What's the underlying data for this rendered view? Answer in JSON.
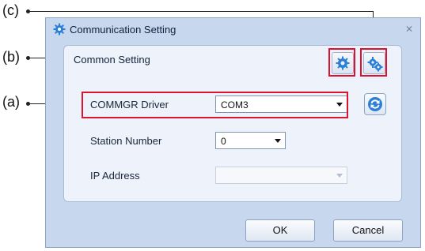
{
  "callouts": {
    "c": "(c)",
    "b": "(b)",
    "a": "(a)"
  },
  "dialog": {
    "title": "Communication Setting",
    "close_glyph": "⨯",
    "group_title": "Common Setting",
    "fields": {
      "driver_label": "COMMGR Driver",
      "driver_value": "COM3",
      "station_label": "Station Number",
      "station_value": "0",
      "ip_label": "IP Address",
      "ip_value": ""
    },
    "ok_label": "OK",
    "cancel_label": "Cancel"
  },
  "icons": {
    "title": "gear-icon",
    "setting_b": "gear-icon",
    "setting_c": "gears-icon",
    "refresh": "refresh-icon"
  },
  "colors": {
    "highlight": "#e0102f",
    "gear": "#2b7fd6",
    "dialog_bg": "#c7d7ee"
  }
}
